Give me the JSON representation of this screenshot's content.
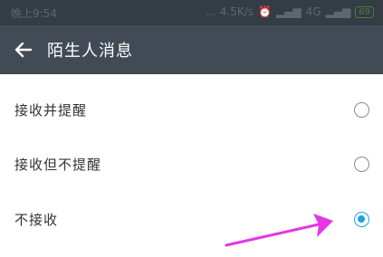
{
  "status_bar": {
    "time": "晚上9:54",
    "network_speed": "... 4.5K/s",
    "signal": "4G",
    "battery": "69"
  },
  "app_bar": {
    "title": "陌生人消息"
  },
  "options": [
    {
      "label": "接收并提醒",
      "selected": false
    },
    {
      "label": "接收但不提醒",
      "selected": false
    },
    {
      "label": "不接收",
      "selected": true
    }
  ],
  "colors": {
    "app_bar": "#414a55",
    "status_bar": "#343c46",
    "accent": "#1fa2e6",
    "annotation_arrow": "#e535e5"
  }
}
